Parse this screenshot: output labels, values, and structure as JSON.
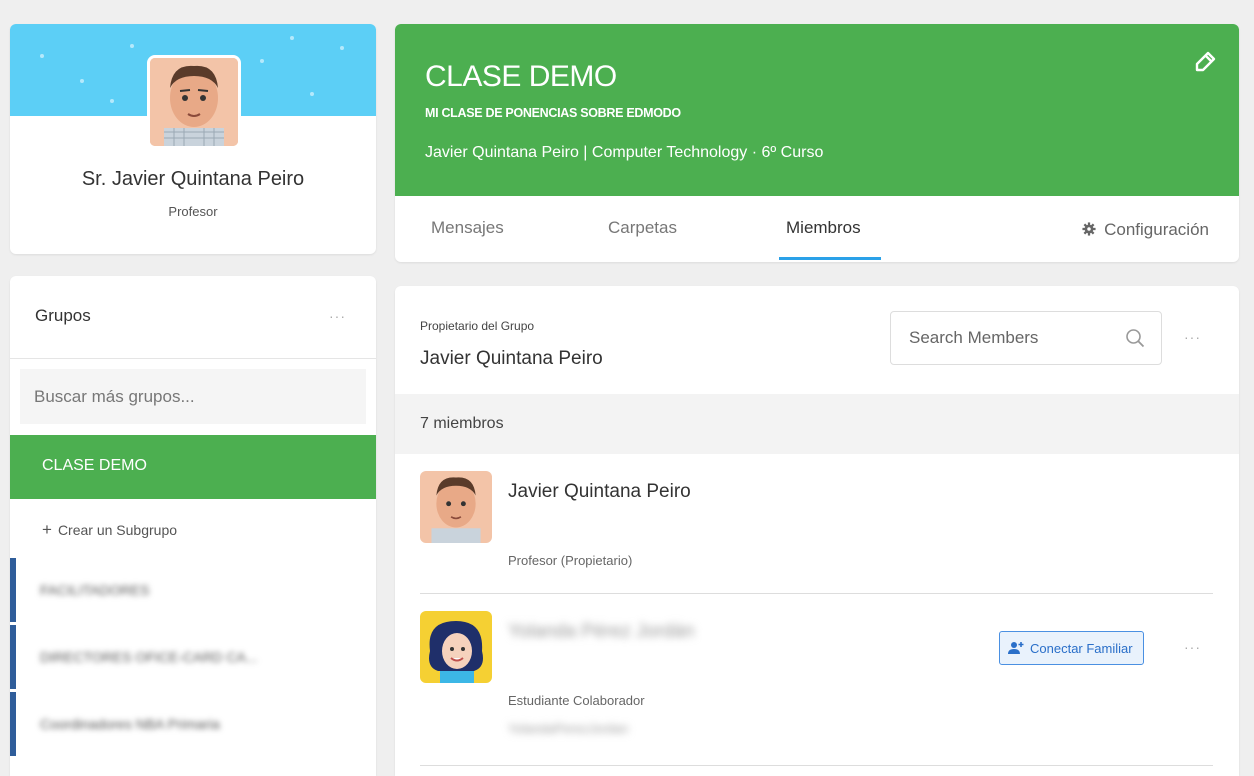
{
  "profile": {
    "name": "Sr. Javier Quintana Peiro",
    "role": "Profesor"
  },
  "sidebar": {
    "groups_title": "Grupos",
    "more": "···",
    "search_placeholder": "Buscar más grupos...",
    "active_group": "CLASE DEMO",
    "create_subgroup": "Crear un Subgrupo",
    "other_groups": [
      "FACILITADORES",
      "DIRECTORES OFICE-CARD CA...",
      "Coordinadores NBA Primaria"
    ]
  },
  "class": {
    "title": "CLASE DEMO",
    "subtitle": "MI CLASE DE PONENCIAS SOBRE EDMODO",
    "info": "Javier Quintana Peiro | Computer Technology · 6º Curso",
    "tabs": [
      "Mensajes",
      "Carpetas",
      "Miembros"
    ],
    "active_tab": "Miembros",
    "settings": "Configuración"
  },
  "members": {
    "owner_label": "Propietario del Grupo",
    "owner_name": "Javier Quintana Peiro",
    "search_placeholder": "Search Members",
    "more": "···",
    "count": "7 miembros",
    "list": [
      {
        "name": "Javier Quintana Peiro",
        "role": "Profesor (Propietario)"
      },
      {
        "name": "Yolanda Pérez Jordán",
        "role": "Estudiante Colaborador",
        "username": "YolandaPerezJordan",
        "connect_label": "Conectar Familiar"
      }
    ]
  },
  "colors": {
    "brand_green": "#4caf50",
    "banner_blue": "#5ccff6",
    "tab_underline": "#2aa1e8",
    "group_border": "#2f5d9a"
  }
}
